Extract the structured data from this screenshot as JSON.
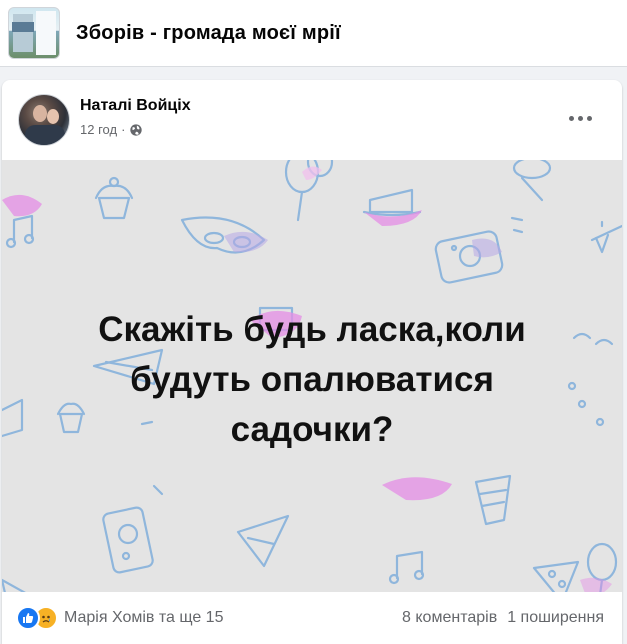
{
  "group": {
    "title": "Зборів - громада моєї мрії"
  },
  "post": {
    "author": "Наталі Войціх",
    "time": "12 год",
    "separator": "·",
    "privacy_icon": "globe-icon",
    "more_icon": "more-options-icon",
    "text_lines": [
      "Скажіть будь ласка,коли",
      "будуть опалюватися",
      "садочки?"
    ],
    "background_style": "party-pattern",
    "colors": {
      "background": "#e4e4e4",
      "doodle": "#8fb6dc",
      "accent": "#e58ee6",
      "text": "#111111"
    }
  },
  "footer": {
    "reaction_icons": [
      "like-icon",
      "sad-icon"
    ],
    "reactors": "Марія Хомів та ще 15",
    "comments": "8 коментарів",
    "shares": "1 поширення"
  }
}
